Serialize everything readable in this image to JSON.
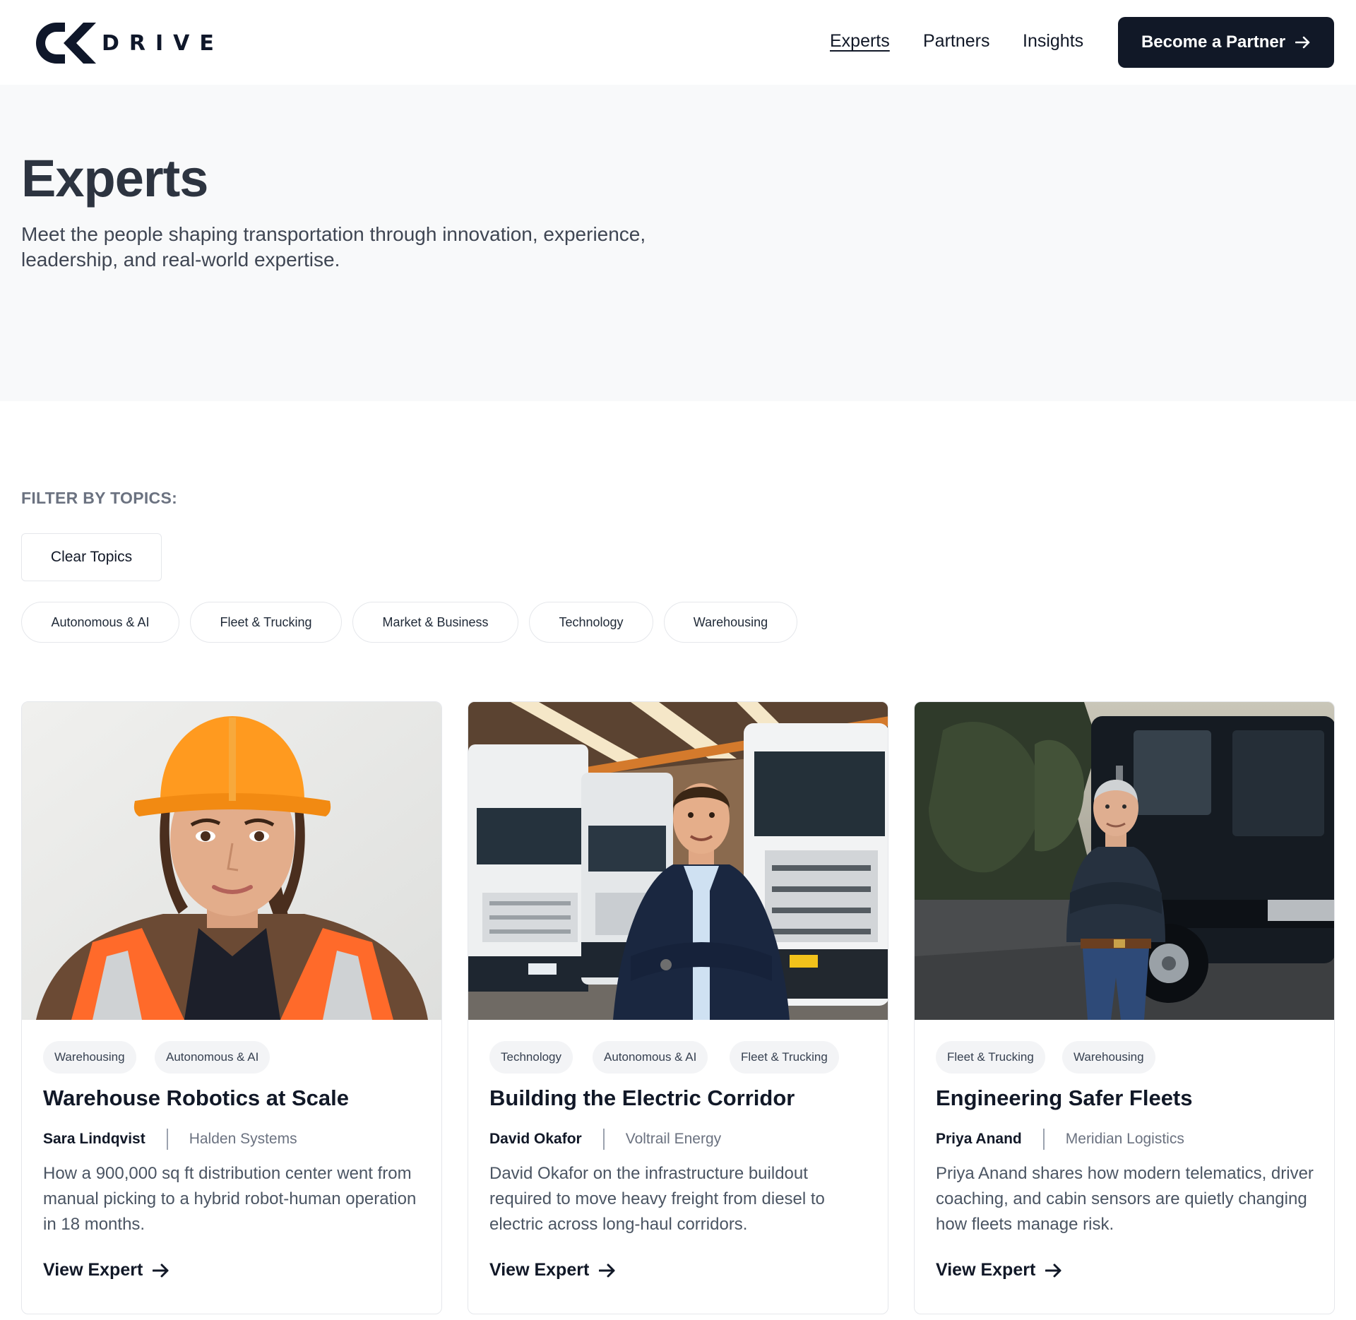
{
  "brand": {
    "logo_text": "DRIVE",
    "accent": "#111827"
  },
  "nav": {
    "links": [
      {
        "label": "Experts",
        "active": true
      },
      {
        "label": "Partners",
        "active": false
      },
      {
        "label": "Insights",
        "active": false
      }
    ],
    "cta_label": "Become a Partner",
    "cta_icon": "arrow-right-icon"
  },
  "hero": {
    "title": "Experts",
    "subtitle": "Meet the people shaping transportation through innovation, experience, leadership, and real-world expertise."
  },
  "filters": {
    "label": "FILTER BY TOPICS:",
    "clear_label": "Clear Topics",
    "topics": [
      "Autonomous & AI",
      "Fleet & Trucking",
      "Market & Business",
      "Technology",
      "Warehousing"
    ]
  },
  "cards": [
    {
      "tags": [
        "Warehousing",
        "Autonomous & AI"
      ],
      "title": "Warehouse Robotics at Scale",
      "author": "Sara Lindqvist",
      "company": "Halden Systems",
      "description": "How a 900,000 sq ft distribution center went from manual picking to a hybrid robot-human operation in 18 months.",
      "link_label": "View Expert"
    },
    {
      "tags": [
        "Technology",
        "Autonomous & AI",
        "Fleet & Trucking"
      ],
      "title": "Building the Electric Corridor",
      "author": "David Okafor",
      "company": "Voltrail Energy",
      "description": "David Okafor on the infrastructure buildout required to move heavy freight from diesel to electric across long-haul corridors.",
      "link_label": "View Expert"
    },
    {
      "tags": [
        "Fleet & Trucking",
        "Warehousing"
      ],
      "title": "Engineering Safer Fleets",
      "author": "Priya Anand",
      "company": "Meridian Logistics",
      "description": "Priya Anand shares how modern telematics, driver coaching, and cabin sensors are quietly changing how fleets manage risk.",
      "link_label": "View Expert"
    }
  ]
}
